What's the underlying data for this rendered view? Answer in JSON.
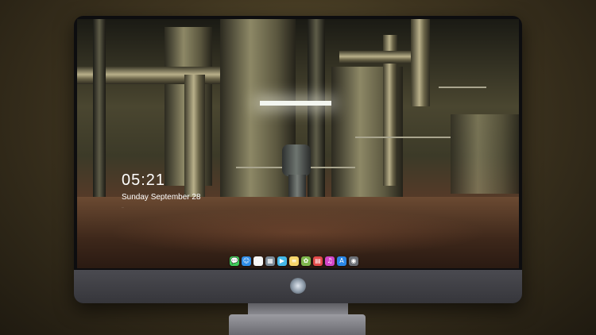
{
  "lock_screen": {
    "time": "05:21",
    "date": "Sunday September  28",
    "note": "..."
  },
  "dock": {
    "apps": [
      {
        "name": "messages-icon",
        "glyph": "💬",
        "color": "#3ecb5a"
      },
      {
        "name": "finder-icon",
        "glyph": "☺",
        "color": "#2f8de8"
      },
      {
        "name": "clock-icon",
        "glyph": "◷",
        "color": "#f5f5f5"
      },
      {
        "name": "preview-icon",
        "glyph": "▦",
        "color": "#7c8a96"
      },
      {
        "name": "movie-icon",
        "glyph": "▶",
        "color": "#45b8e8"
      },
      {
        "name": "notes-icon",
        "glyph": "≡",
        "color": "#f6d56b"
      },
      {
        "name": "photos-icon",
        "glyph": "✿",
        "color": "#7fb64d"
      },
      {
        "name": "calendar-icon",
        "glyph": "▤",
        "color": "#e24a4a"
      },
      {
        "name": "music-icon",
        "glyph": "♫",
        "color": "#d245c8"
      },
      {
        "name": "app-store-icon",
        "glyph": "A",
        "color": "#2a86e6"
      },
      {
        "name": "camera-icon",
        "glyph": "◉",
        "color": "#6c7077"
      }
    ]
  }
}
